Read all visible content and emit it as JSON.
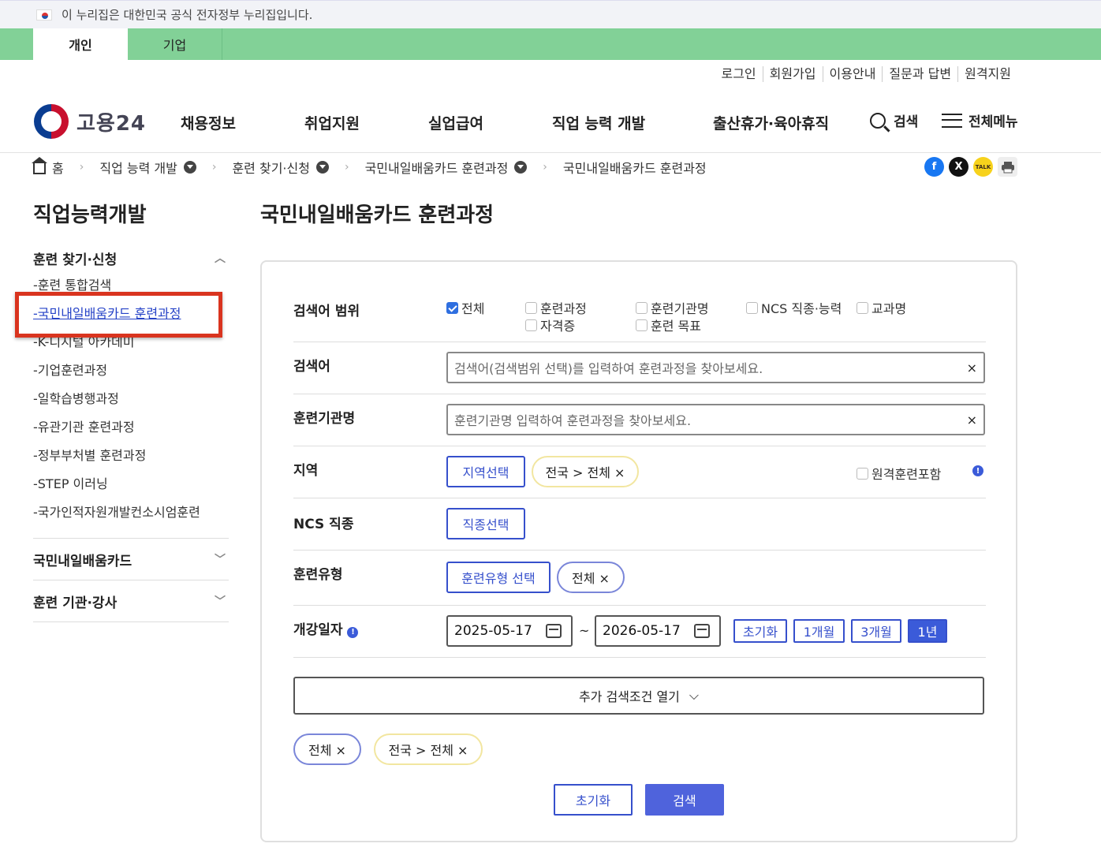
{
  "gov_bar": {
    "text": "이 누리집은 대한민국 공식 전자정부 누리집입니다."
  },
  "top_tabs": [
    {
      "label": "개인"
    },
    {
      "label": "기업"
    }
  ],
  "util_links": [
    "로그인",
    "회원가입",
    "이용안내",
    "질문과 답변",
    "원격지원"
  ],
  "logo": {
    "text": "고용24"
  },
  "gnb": [
    "채용정보",
    "취업지원",
    "실업급여",
    "직업 능력 개발",
    "출산휴가·육아휴직"
  ],
  "header_buttons": {
    "search": "검색",
    "menu": "전체메뉴"
  },
  "breadcrumb": [
    "홈",
    "직업 능력 개발",
    "훈련 찾기·신청",
    "국민내일배움카드 훈련과정",
    "국민내일배움카드 훈련과정"
  ],
  "share": {
    "facebook": "f",
    "x": "X",
    "kakao": "TALK"
  },
  "lnb": {
    "title": "직업능력개발",
    "section1": "훈련 찾기·신청",
    "items": [
      "-훈련 통합검색",
      "-국민내일배움카드 훈련과정",
      "-K-디지털 아카데미",
      "-기업훈련과정",
      "-일학습병행과정",
      "-유관기관 훈련과정",
      "-정부부처별 훈련과정",
      "-STEP 이러닝",
      "-국가인적자원개발컨소시엄훈련"
    ],
    "section2": "국민내일배움카드",
    "section3": "훈련 기관·강사"
  },
  "page_title": "국민내일배움카드 훈련과정",
  "form": {
    "scope_label": "검색어 범위",
    "scope_options": [
      "전체",
      "훈련과정",
      "훈련기관명",
      "NCS 직종·능력",
      "교과명",
      "자격증",
      "훈련 목표"
    ],
    "keyword_label": "검색어",
    "keyword_placeholder": "검색어(검색범위 선택)를 입력하여 훈련과정을 찾아보세요.",
    "org_label": "훈련기관명",
    "org_placeholder": "훈련기관명 입력하여 훈련과정을 찾아보세요.",
    "clear": "×",
    "region_label": "지역",
    "region_btn": "지역선택",
    "region_chip": "전국 > 전체 ×",
    "remote_label": "원격훈련포함",
    "info": "!",
    "ncs_label": "NCS 직종",
    "ncs_btn": "직종선택",
    "type_label": "훈련유형",
    "type_btn": "훈련유형 선택",
    "type_chip": "전체 ×",
    "date_label": "개강일자",
    "date_from": "2025-05-17",
    "date_to": "2026-05-17",
    "tilde": "~",
    "range_btns": [
      "초기화",
      "1개월",
      "3개월",
      "1년"
    ],
    "more": "추가 검색조건 열기",
    "more_chevron": "⌵",
    "chips": [
      "전체 ×",
      "전국 > 전체 ×"
    ],
    "reset": "초기화",
    "search": "검색"
  }
}
